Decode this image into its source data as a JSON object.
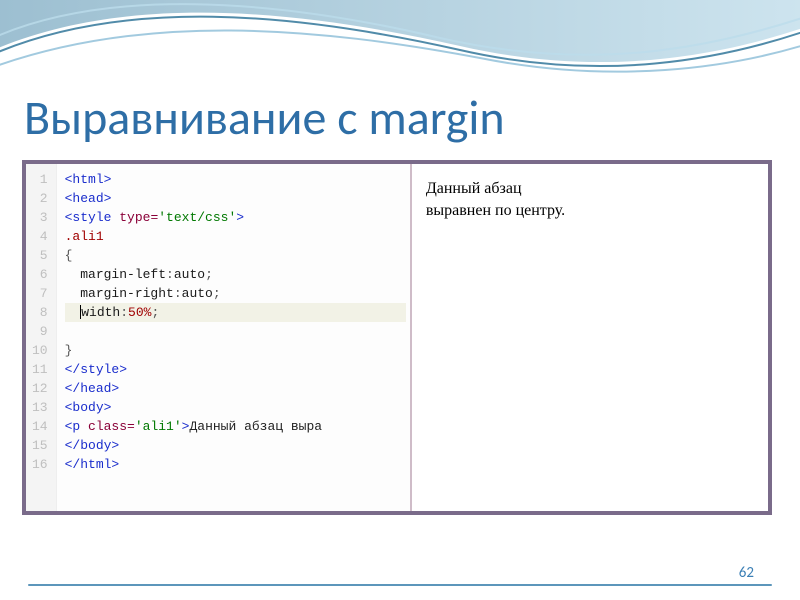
{
  "slide": {
    "title": "Выравнивание с margin",
    "page_number": "62"
  },
  "code": {
    "lines": [
      {
        "n": "1",
        "type": "tag-only",
        "tag": "<html>"
      },
      {
        "n": "2",
        "type": "tag-only",
        "tag": "<head>"
      },
      {
        "n": "3",
        "type": "style-open",
        "tag_open": "<style",
        "attr_name": "type",
        "attr_val": "'text/css'",
        "tag_close": ">"
      },
      {
        "n": "4",
        "type": "selector",
        "sel": ".ali1"
      },
      {
        "n": "5",
        "type": "brace",
        "text": "{"
      },
      {
        "n": "6",
        "type": "decl",
        "prop": "margin-left",
        "val": "auto",
        "val_kind": "kw"
      },
      {
        "n": "7",
        "type": "decl",
        "prop": "margin-right",
        "val": "auto",
        "val_kind": "kw"
      },
      {
        "n": "8",
        "type": "decl-hl",
        "prop": "width",
        "val": "50%",
        "val_kind": "pct"
      },
      {
        "n": "9",
        "type": "brace",
        "text": "}"
      },
      {
        "n": "10",
        "type": "tag-only",
        "tag": "</style>"
      },
      {
        "n": "11",
        "type": "tag-only",
        "tag": "</head>"
      },
      {
        "n": "12",
        "type": "tag-only",
        "tag": "<body>"
      },
      {
        "n": "13",
        "type": "p-line",
        "tag_open": "<p",
        "attr_name": "class",
        "attr_val": "'ali1'",
        "tag_close": ">",
        "text": "Данный абзац выра"
      },
      {
        "n": "14",
        "type": "tag-only",
        "tag": "</body>"
      },
      {
        "n": "15",
        "type": "tag-only",
        "tag": "</html>"
      },
      {
        "n": "16",
        "type": "empty"
      }
    ]
  },
  "preview": {
    "line1": "Данный абзац",
    "line2": "выравнен по центру."
  },
  "colors": {
    "title": "#2e6ea6",
    "accent": "#5c96bb",
    "frame": "#7a6b8a"
  }
}
